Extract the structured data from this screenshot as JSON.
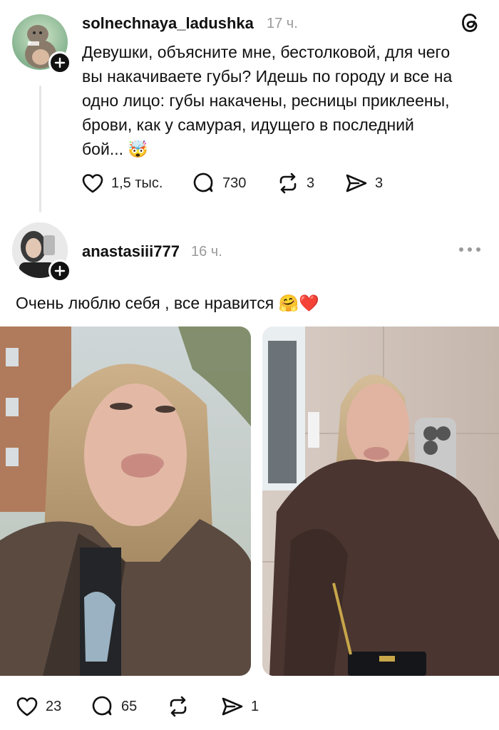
{
  "post1": {
    "username": "solnechnaya_ladushka",
    "time": "17 ч.",
    "lines": [
      "Девушки, объясните мне, бестолковой, для чего",
      "вы накачиваете губы? Идешь по городу и все на",
      "одно лицо: губы накачены, ресницы приклеены,",
      "брови, как у самурая, идущего в последний",
      "бой..."
    ],
    "emoji": "🤯",
    "likes": "1,5 тыс.",
    "comments": "730",
    "reposts": "3",
    "shares": "3"
  },
  "post2": {
    "username": "anastasiii777",
    "time": "16 ч.",
    "text": "Очень люблю себя , все нравится",
    "emojis": "🤗❤️",
    "likes": "23",
    "comments": "65",
    "shares": "1"
  },
  "icons": {
    "threads_logo": "threads-logo-icon",
    "heart": "heart-icon",
    "comment": "comment-icon",
    "repost": "repost-icon",
    "share": "share-icon",
    "more": "more-icon",
    "plus": "plus-icon"
  },
  "colors": {
    "text": "#111111",
    "muted": "#9a9a9a",
    "background": "#ffffff"
  }
}
